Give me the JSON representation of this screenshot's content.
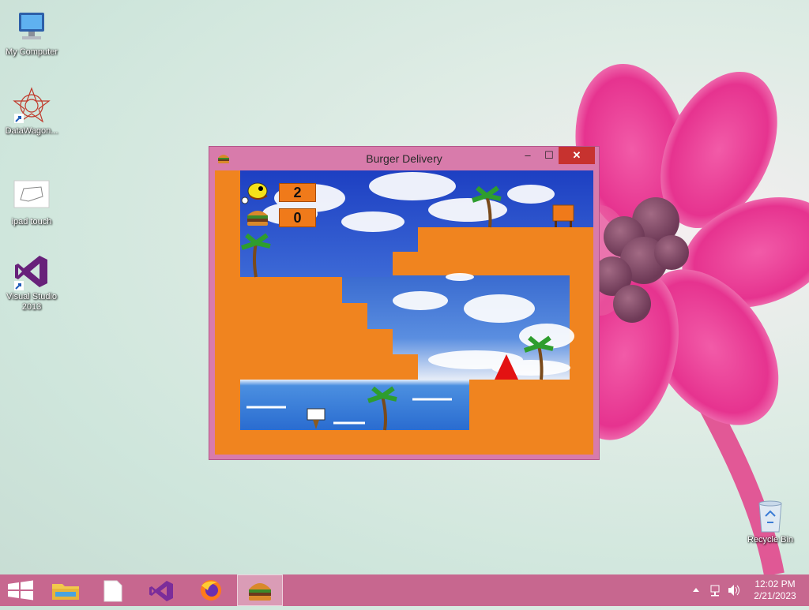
{
  "desktop": {
    "icons": [
      {
        "label": "My Computer"
      },
      {
        "label": "DataWagon..."
      },
      {
        "label": "ipad touch"
      },
      {
        "label": "Visual Studio 2013"
      },
      {
        "label": "Recycle Bin"
      }
    ]
  },
  "window": {
    "title": "Burger Delivery",
    "controls": {
      "minimize": "–",
      "maximize": "☐",
      "close": "✕"
    }
  },
  "game": {
    "lives": "2",
    "burgers": "0"
  },
  "taskbar": {
    "items": [
      "start-button",
      "file-explorer",
      "blank-document",
      "visual-studio",
      "firefox",
      "burger-delivery"
    ],
    "active_item": "burger-delivery",
    "clock": {
      "time": "12:02 PM",
      "date": "2/21/2023"
    }
  },
  "colors": {
    "window_frame": "#d87bab",
    "close_button": "#c7322f",
    "taskbar": "#c7678f",
    "ground": "#f0841f"
  }
}
